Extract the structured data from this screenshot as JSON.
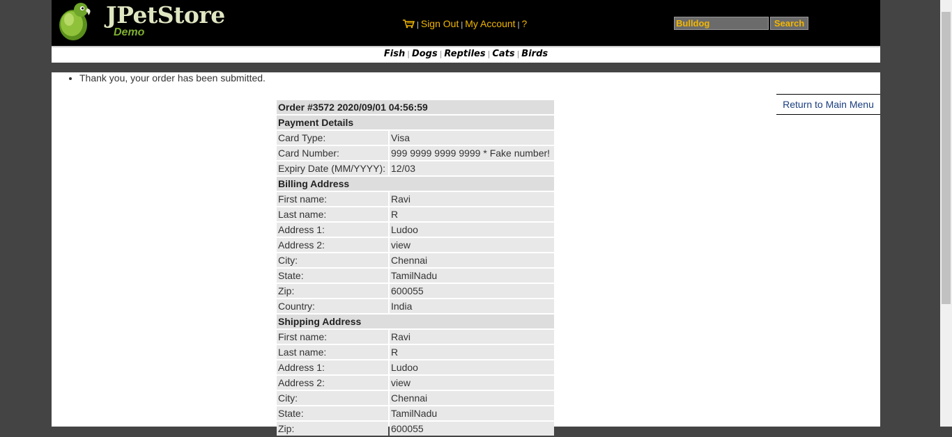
{
  "header": {
    "logo_title": "JPetStore",
    "logo_subtitle": "Demo",
    "menu": {
      "sign_out": "Sign Out",
      "my_account": "My Account",
      "help": "?",
      "cart_icon": "cart-icon"
    },
    "search": {
      "value": "Bulldog",
      "button_label": "Search"
    }
  },
  "quicklinks": [
    "Fish",
    "Dogs",
    "Reptiles",
    "Cats",
    "Birds"
  ],
  "messages": [
    "Thank you, your order has been submitted."
  ],
  "return_link": "Return to Main Menu",
  "order": {
    "title": "Order #3572 2020/09/01 04:56:59",
    "payment_header": "Payment Details",
    "payment": [
      {
        "label": "Card Type:",
        "value": "Visa"
      },
      {
        "label": "Card Number:",
        "value": "999 9999 9999 9999 * Fake number!"
      },
      {
        "label": "Expiry Date (MM/YYYY):",
        "value": "12/03"
      }
    ],
    "billing_header": "Billing Address",
    "billing": [
      {
        "label": "First name:",
        "value": "Ravi"
      },
      {
        "label": "Last name:",
        "value": "R"
      },
      {
        "label": "Address 1:",
        "value": "Ludoo"
      },
      {
        "label": "Address 2:",
        "value": "view"
      },
      {
        "label": "City:",
        "value": "Chennai"
      },
      {
        "label": "State:",
        "value": "TamilNadu"
      },
      {
        "label": "Zip:",
        "value": "600055"
      },
      {
        "label": "Country:",
        "value": "India"
      }
    ],
    "shipping_header": "Shipping Address",
    "shipping": [
      {
        "label": "First name:",
        "value": "Ravi"
      },
      {
        "label": "Last name:",
        "value": "R"
      },
      {
        "label": "Address 1:",
        "value": "Ludoo"
      },
      {
        "label": "Address 2:",
        "value": "view"
      },
      {
        "label": "City:",
        "value": "Chennai"
      },
      {
        "label": "State:",
        "value": "TamilNadu"
      },
      {
        "label": "Zip:",
        "value": "600055"
      }
    ]
  },
  "colors": {
    "header_bg": "#000000",
    "link_accent": "#f2b600",
    "return_link": "#1a3e7f",
    "outer_bg": "#444444"
  }
}
